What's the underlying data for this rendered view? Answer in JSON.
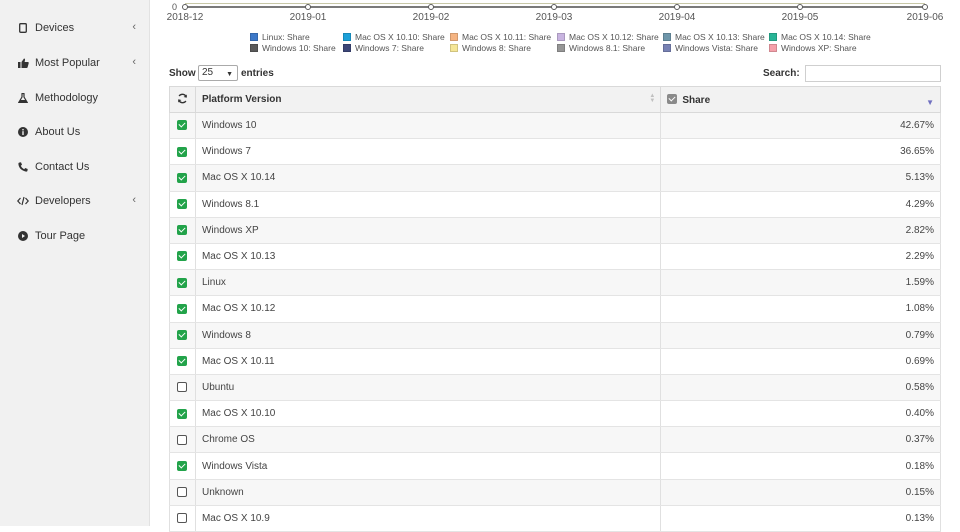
{
  "sidebar": {
    "items": [
      {
        "label": "Devices",
        "icon": "tablet-icon",
        "has_chevron": true
      },
      {
        "label": "Most Popular",
        "icon": "thumbs-up-icon",
        "has_chevron": true
      },
      {
        "label": "Methodology",
        "icon": "flask-icon",
        "has_chevron": false
      },
      {
        "label": "About Us",
        "icon": "info-circle-icon",
        "has_chevron": false
      },
      {
        "label": "Contact Us",
        "icon": "phone-icon",
        "has_chevron": false
      },
      {
        "label": "Developers",
        "icon": "code-icon",
        "has_chevron": true
      },
      {
        "label": "Tour Page",
        "icon": "play-circle-icon",
        "has_chevron": false
      }
    ]
  },
  "chart_axis": {
    "zero_label": "0",
    "ticks": [
      "2018-12",
      "2019-01",
      "2019-02",
      "2019-03",
      "2019-04",
      "2019-05",
      "2019-06"
    ]
  },
  "legend": [
    {
      "label": "Linux: Share",
      "color": "#3c78c8"
    },
    {
      "label": "Mac OS X 10.10: Share",
      "color": "#1ca0d8"
    },
    {
      "label": "Mac OS X 10.11: Share",
      "color": "#f5b482"
    },
    {
      "label": "Mac OS X 10.12: Share",
      "color": "#c8b4e0"
    },
    {
      "label": "Mac OS X 10.13: Share",
      "color": "#6e96aa"
    },
    {
      "label": "Mac OS X 10.14: Share",
      "color": "#28b496"
    },
    {
      "label": "Windows 10: Share",
      "color": "#5a5a5a"
    },
    {
      "label": "Windows 7: Share",
      "color": "#3c4678"
    },
    {
      "label": "Windows 8: Share",
      "color": "#f5e696"
    },
    {
      "label": "Windows 8.1: Share",
      "color": "#969696"
    },
    {
      "label": "Windows Vista: Share",
      "color": "#7882b4"
    },
    {
      "label": "Windows XP: Share",
      "color": "#f5a0aa"
    }
  ],
  "controls": {
    "show_label": "Show",
    "page_size": "25",
    "entries_label": "entries",
    "search_label": "Search:",
    "search_value": ""
  },
  "table": {
    "headers": {
      "platform": "Platform Version",
      "share": "Share"
    },
    "rows": [
      {
        "platform": "Windows 10",
        "share": "42.67%",
        "checked": true
      },
      {
        "platform": "Windows 7",
        "share": "36.65%",
        "checked": true
      },
      {
        "platform": "Mac OS X 10.14",
        "share": "5.13%",
        "checked": true
      },
      {
        "platform": "Windows 8.1",
        "share": "4.29%",
        "checked": true
      },
      {
        "platform": "Windows XP",
        "share": "2.82%",
        "checked": true
      },
      {
        "platform": "Mac OS X 10.13",
        "share": "2.29%",
        "checked": true
      },
      {
        "platform": "Linux",
        "share": "1.59%",
        "checked": true
      },
      {
        "platform": "Mac OS X 10.12",
        "share": "1.08%",
        "checked": true
      },
      {
        "platform": "Windows 8",
        "share": "0.79%",
        "checked": true
      },
      {
        "platform": "Mac OS X 10.11",
        "share": "0.69%",
        "checked": true
      },
      {
        "platform": "Ubuntu",
        "share": "0.58%",
        "checked": false
      },
      {
        "platform": "Mac OS X 10.10",
        "share": "0.40%",
        "checked": true
      },
      {
        "platform": "Chrome OS",
        "share": "0.37%",
        "checked": false
      },
      {
        "platform": "Windows Vista",
        "share": "0.18%",
        "checked": true
      },
      {
        "platform": "Unknown",
        "share": "0.15%",
        "checked": false
      },
      {
        "platform": "Mac OS X 10.9",
        "share": "0.13%",
        "checked": false
      }
    ]
  }
}
